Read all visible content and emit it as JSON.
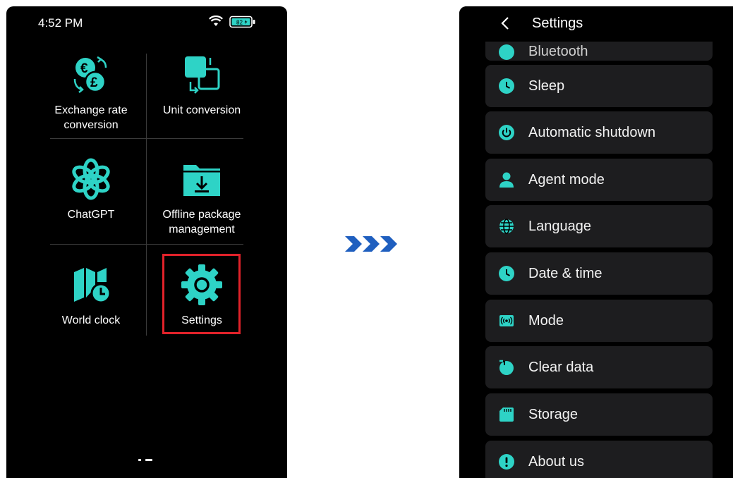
{
  "left_screen": {
    "status": {
      "time": "4:52 PM",
      "battery": "82"
    },
    "apps": [
      {
        "label": "Exchange rate conversion",
        "icon": "currency-exchange-icon"
      },
      {
        "label": "Unit conversion",
        "icon": "unit-conversion-icon"
      },
      {
        "label": "ChatGPT",
        "icon": "chatgpt-icon"
      },
      {
        "label": "Offline package management",
        "icon": "download-folder-icon"
      },
      {
        "label": "World clock",
        "icon": "map-clock-icon"
      },
      {
        "label": "Settings",
        "icon": "gear-icon"
      }
    ]
  },
  "right_screen": {
    "header": {
      "title": "Settings"
    },
    "items": [
      {
        "label": "Bluetooth",
        "icon": "bluetooth-icon"
      },
      {
        "label": "Sleep",
        "icon": "clock-icon"
      },
      {
        "label": "Automatic shutdown",
        "icon": "power-icon"
      },
      {
        "label": "Agent mode",
        "icon": "person-icon"
      },
      {
        "label": "Language",
        "icon": "globe-icon"
      },
      {
        "label": "Date & time",
        "icon": "clock-icon"
      },
      {
        "label": "Mode",
        "icon": "broadcast-icon"
      },
      {
        "label": "Clear data",
        "icon": "clear-data-icon"
      },
      {
        "label": "Storage",
        "icon": "sd-card-icon"
      },
      {
        "label": "About us",
        "icon": "info-icon"
      }
    ]
  },
  "colors": {
    "accent": "#2ed3c6",
    "background": "#000000",
    "item_background": "#1d1d1f",
    "highlight": "#e2222a",
    "arrow": "#1f5fbf"
  }
}
